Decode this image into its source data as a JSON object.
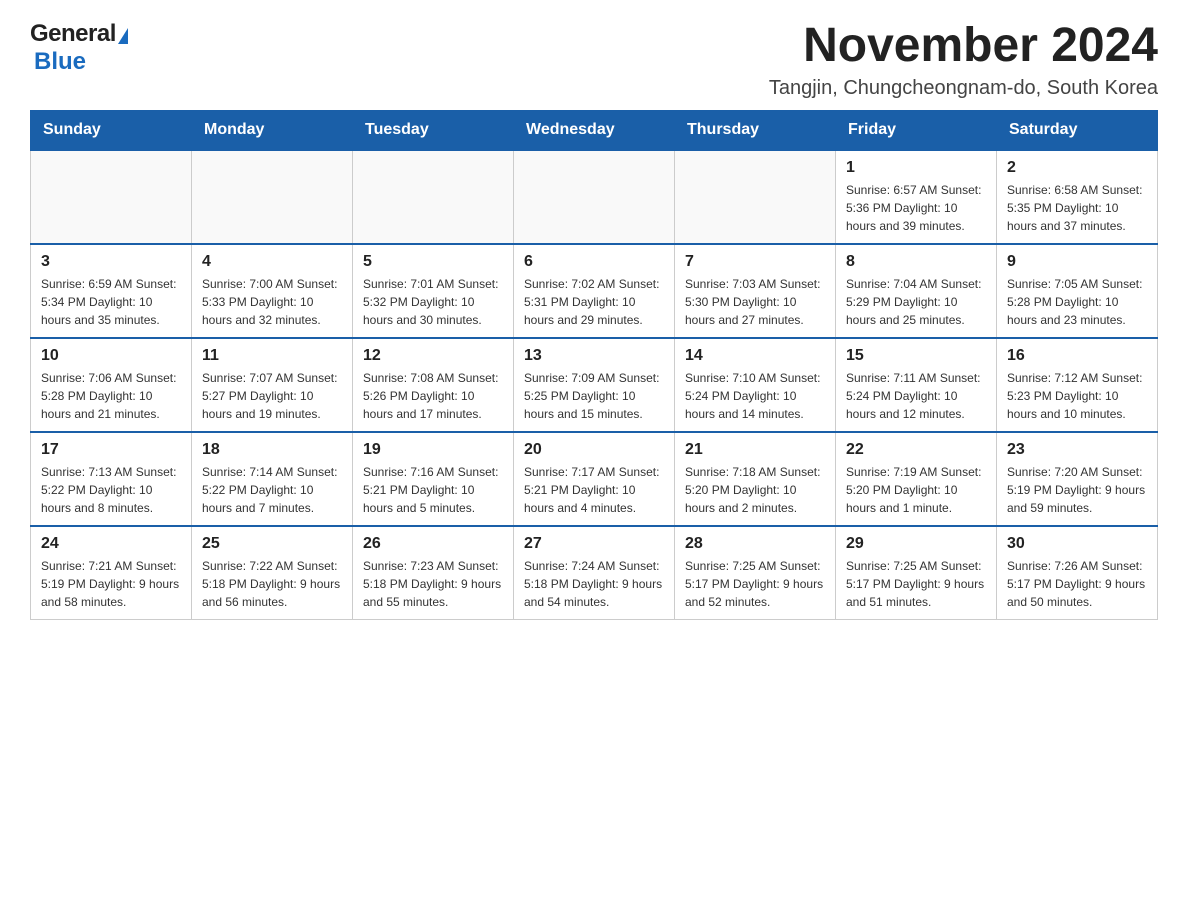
{
  "header": {
    "logo_general": "General",
    "logo_blue": "Blue",
    "title": "November 2024",
    "subtitle": "Tangjin, Chungcheongnam-do, South Korea"
  },
  "days_of_week": [
    "Sunday",
    "Monday",
    "Tuesday",
    "Wednesday",
    "Thursday",
    "Friday",
    "Saturday"
  ],
  "weeks": [
    [
      {
        "day": "",
        "info": ""
      },
      {
        "day": "",
        "info": ""
      },
      {
        "day": "",
        "info": ""
      },
      {
        "day": "",
        "info": ""
      },
      {
        "day": "",
        "info": ""
      },
      {
        "day": "1",
        "info": "Sunrise: 6:57 AM\nSunset: 5:36 PM\nDaylight: 10 hours\nand 39 minutes."
      },
      {
        "day": "2",
        "info": "Sunrise: 6:58 AM\nSunset: 5:35 PM\nDaylight: 10 hours\nand 37 minutes."
      }
    ],
    [
      {
        "day": "3",
        "info": "Sunrise: 6:59 AM\nSunset: 5:34 PM\nDaylight: 10 hours\nand 35 minutes."
      },
      {
        "day": "4",
        "info": "Sunrise: 7:00 AM\nSunset: 5:33 PM\nDaylight: 10 hours\nand 32 minutes."
      },
      {
        "day": "5",
        "info": "Sunrise: 7:01 AM\nSunset: 5:32 PM\nDaylight: 10 hours\nand 30 minutes."
      },
      {
        "day": "6",
        "info": "Sunrise: 7:02 AM\nSunset: 5:31 PM\nDaylight: 10 hours\nand 29 minutes."
      },
      {
        "day": "7",
        "info": "Sunrise: 7:03 AM\nSunset: 5:30 PM\nDaylight: 10 hours\nand 27 minutes."
      },
      {
        "day": "8",
        "info": "Sunrise: 7:04 AM\nSunset: 5:29 PM\nDaylight: 10 hours\nand 25 minutes."
      },
      {
        "day": "9",
        "info": "Sunrise: 7:05 AM\nSunset: 5:28 PM\nDaylight: 10 hours\nand 23 minutes."
      }
    ],
    [
      {
        "day": "10",
        "info": "Sunrise: 7:06 AM\nSunset: 5:28 PM\nDaylight: 10 hours\nand 21 minutes."
      },
      {
        "day": "11",
        "info": "Sunrise: 7:07 AM\nSunset: 5:27 PM\nDaylight: 10 hours\nand 19 minutes."
      },
      {
        "day": "12",
        "info": "Sunrise: 7:08 AM\nSunset: 5:26 PM\nDaylight: 10 hours\nand 17 minutes."
      },
      {
        "day": "13",
        "info": "Sunrise: 7:09 AM\nSunset: 5:25 PM\nDaylight: 10 hours\nand 15 minutes."
      },
      {
        "day": "14",
        "info": "Sunrise: 7:10 AM\nSunset: 5:24 PM\nDaylight: 10 hours\nand 14 minutes."
      },
      {
        "day": "15",
        "info": "Sunrise: 7:11 AM\nSunset: 5:24 PM\nDaylight: 10 hours\nand 12 minutes."
      },
      {
        "day": "16",
        "info": "Sunrise: 7:12 AM\nSunset: 5:23 PM\nDaylight: 10 hours\nand 10 minutes."
      }
    ],
    [
      {
        "day": "17",
        "info": "Sunrise: 7:13 AM\nSunset: 5:22 PM\nDaylight: 10 hours\nand 8 minutes."
      },
      {
        "day": "18",
        "info": "Sunrise: 7:14 AM\nSunset: 5:22 PM\nDaylight: 10 hours\nand 7 minutes."
      },
      {
        "day": "19",
        "info": "Sunrise: 7:16 AM\nSunset: 5:21 PM\nDaylight: 10 hours\nand 5 minutes."
      },
      {
        "day": "20",
        "info": "Sunrise: 7:17 AM\nSunset: 5:21 PM\nDaylight: 10 hours\nand 4 minutes."
      },
      {
        "day": "21",
        "info": "Sunrise: 7:18 AM\nSunset: 5:20 PM\nDaylight: 10 hours\nand 2 minutes."
      },
      {
        "day": "22",
        "info": "Sunrise: 7:19 AM\nSunset: 5:20 PM\nDaylight: 10 hours\nand 1 minute."
      },
      {
        "day": "23",
        "info": "Sunrise: 7:20 AM\nSunset: 5:19 PM\nDaylight: 9 hours\nand 59 minutes."
      }
    ],
    [
      {
        "day": "24",
        "info": "Sunrise: 7:21 AM\nSunset: 5:19 PM\nDaylight: 9 hours\nand 58 minutes."
      },
      {
        "day": "25",
        "info": "Sunrise: 7:22 AM\nSunset: 5:18 PM\nDaylight: 9 hours\nand 56 minutes."
      },
      {
        "day": "26",
        "info": "Sunrise: 7:23 AM\nSunset: 5:18 PM\nDaylight: 9 hours\nand 55 minutes."
      },
      {
        "day": "27",
        "info": "Sunrise: 7:24 AM\nSunset: 5:18 PM\nDaylight: 9 hours\nand 54 minutes."
      },
      {
        "day": "28",
        "info": "Sunrise: 7:25 AM\nSunset: 5:17 PM\nDaylight: 9 hours\nand 52 minutes."
      },
      {
        "day": "29",
        "info": "Sunrise: 7:25 AM\nSunset: 5:17 PM\nDaylight: 9 hours\nand 51 minutes."
      },
      {
        "day": "30",
        "info": "Sunrise: 7:26 AM\nSunset: 5:17 PM\nDaylight: 9 hours\nand 50 minutes."
      }
    ]
  ]
}
